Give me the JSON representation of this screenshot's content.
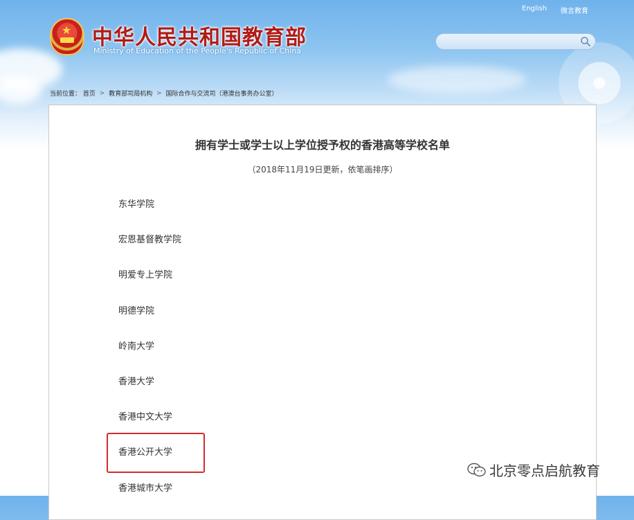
{
  "header": {
    "title_cn": "中华人民共和国教育部",
    "title_en": "Ministry of Education of the People's Republic of China",
    "links": {
      "english": "English",
      "weibo": "微言教育"
    },
    "search": {
      "value": "",
      "placeholder": ""
    }
  },
  "breadcrumb": {
    "prefix": "当前位置：",
    "items": [
      "首页",
      "教育部司局机构",
      "国际合作与交流司（港澳台事务办公室）"
    ]
  },
  "article": {
    "title": "拥有学士或学士以上学位授予权的香港高等学校名单",
    "subtitle": "（2018年11月19日更新，依笔画排序）",
    "schools": [
      "东华学院",
      "宏恩基督教学院",
      "明爱专上学院",
      "明德学院",
      "岭南大学",
      "香港大学",
      "香港中文大学",
      "香港公开大学",
      "香港城市大学"
    ]
  },
  "watermark": {
    "text": "北京零点启航教育",
    "icon": "wechat-icon"
  },
  "colors": {
    "title_red": "#b11b16",
    "highlight_red": "#d12b2b",
    "sky": "#6fb2ec"
  }
}
